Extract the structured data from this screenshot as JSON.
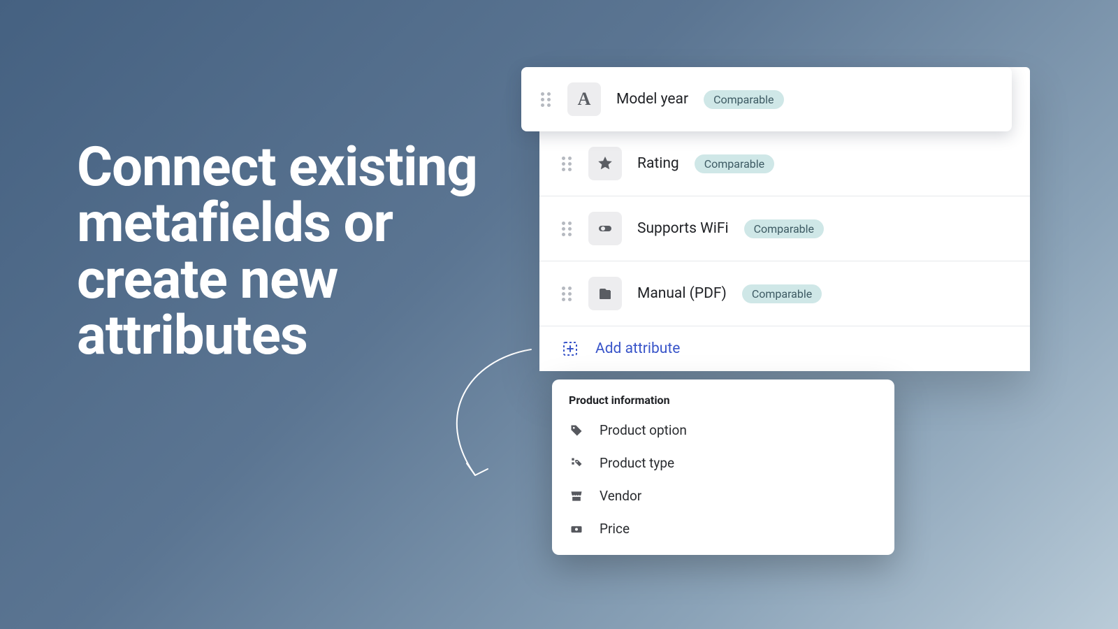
{
  "headline": "Connect existing metafields or create new attributes",
  "badge": "Comparable",
  "attributes": [
    {
      "label": "Model year"
    },
    {
      "label": "Rating"
    },
    {
      "label": "Supports WiFi"
    },
    {
      "label": "Manual (PDF)"
    }
  ],
  "addRow": {
    "label": "Add attribute"
  },
  "popover": {
    "title": "Product information",
    "items": [
      {
        "label": "Product option"
      },
      {
        "label": "Product type"
      },
      {
        "label": "Vendor"
      },
      {
        "label": "Price"
      }
    ]
  }
}
